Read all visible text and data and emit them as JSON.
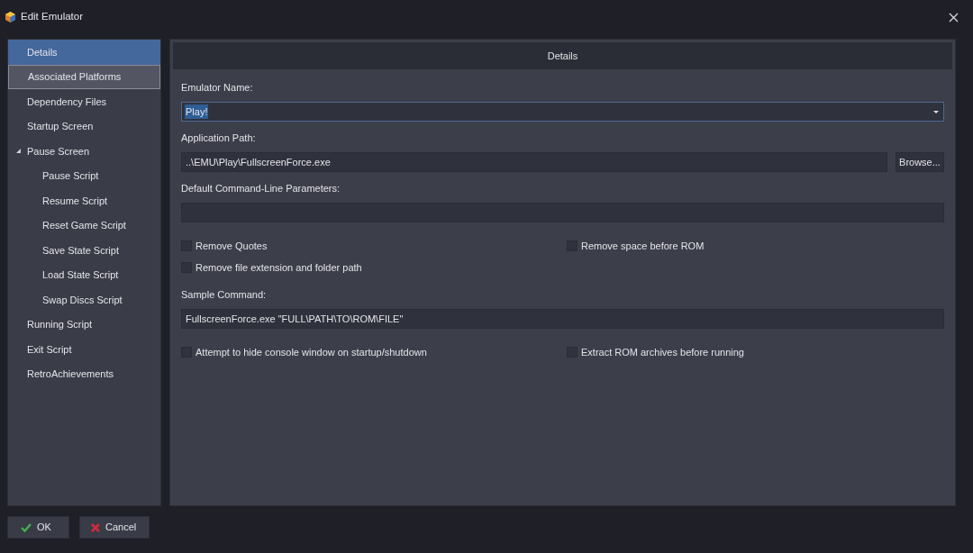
{
  "window": {
    "title": "Edit Emulator"
  },
  "sidebar": {
    "items": [
      {
        "label": "Details",
        "selected": true,
        "hovered": false
      },
      {
        "label": "Associated Platforms",
        "selected": false,
        "hovered": true
      },
      {
        "label": "Dependency Files",
        "selected": false,
        "hovered": false
      },
      {
        "label": "Startup Screen",
        "selected": false,
        "hovered": false
      },
      {
        "label": "Pause Screen",
        "selected": false,
        "hovered": false,
        "expanded": true,
        "children": [
          {
            "label": "Pause Script",
            "selected": false,
            "hovered": false
          },
          {
            "label": "Resume Script",
            "selected": false,
            "hovered": false
          },
          {
            "label": "Reset Game Script",
            "selected": false,
            "hovered": false
          },
          {
            "label": "Save State Script",
            "selected": false,
            "hovered": false
          },
          {
            "label": "Load State Script",
            "selected": false,
            "hovered": false
          },
          {
            "label": "Swap Discs Script",
            "selected": false,
            "hovered": false
          }
        ]
      },
      {
        "label": "Running Script",
        "selected": false,
        "hovered": false
      },
      {
        "label": "Exit Script",
        "selected": false,
        "hovered": false
      },
      {
        "label": "RetroAchievements",
        "selected": false,
        "hovered": false
      }
    ]
  },
  "panel": {
    "header": "Details",
    "rows": [
      {
        "kind": "combo",
        "label": "Emulator Name:",
        "value": "Play!",
        "text_selected": true
      },
      {
        "kind": "text",
        "label": "Application Path:",
        "value": "..\\EMU\\Play\\FullscreenForce.exe",
        "button": "Browse..."
      },
      {
        "kind": "text",
        "label": "Default Command-Line Parameters:"
      },
      {
        "kind": "checks",
        "items": [
          {
            "label": "Remove Quotes",
            "checked": false
          },
          {
            "label": "Remove space before ROM",
            "checked": false
          },
          {
            "label": "Remove file extension and folder path",
            "checked": false
          }
        ]
      },
      {
        "kind": "text",
        "label": "Sample Command:",
        "value": "FullscreenForce.exe \"FULL\\PATH\\TO\\ROM\\FILE\""
      },
      {
        "kind": "checks",
        "items": [
          {
            "label": "Attempt to hide console window on startup/shutdown",
            "checked": false
          },
          {
            "label": "Extract ROM archives before running",
            "checked": false
          }
        ]
      }
    ]
  },
  "buttons": [
    {
      "label": "OK",
      "kind": "ok"
    },
    {
      "label": "Cancel",
      "kind": "cancel"
    }
  ]
}
